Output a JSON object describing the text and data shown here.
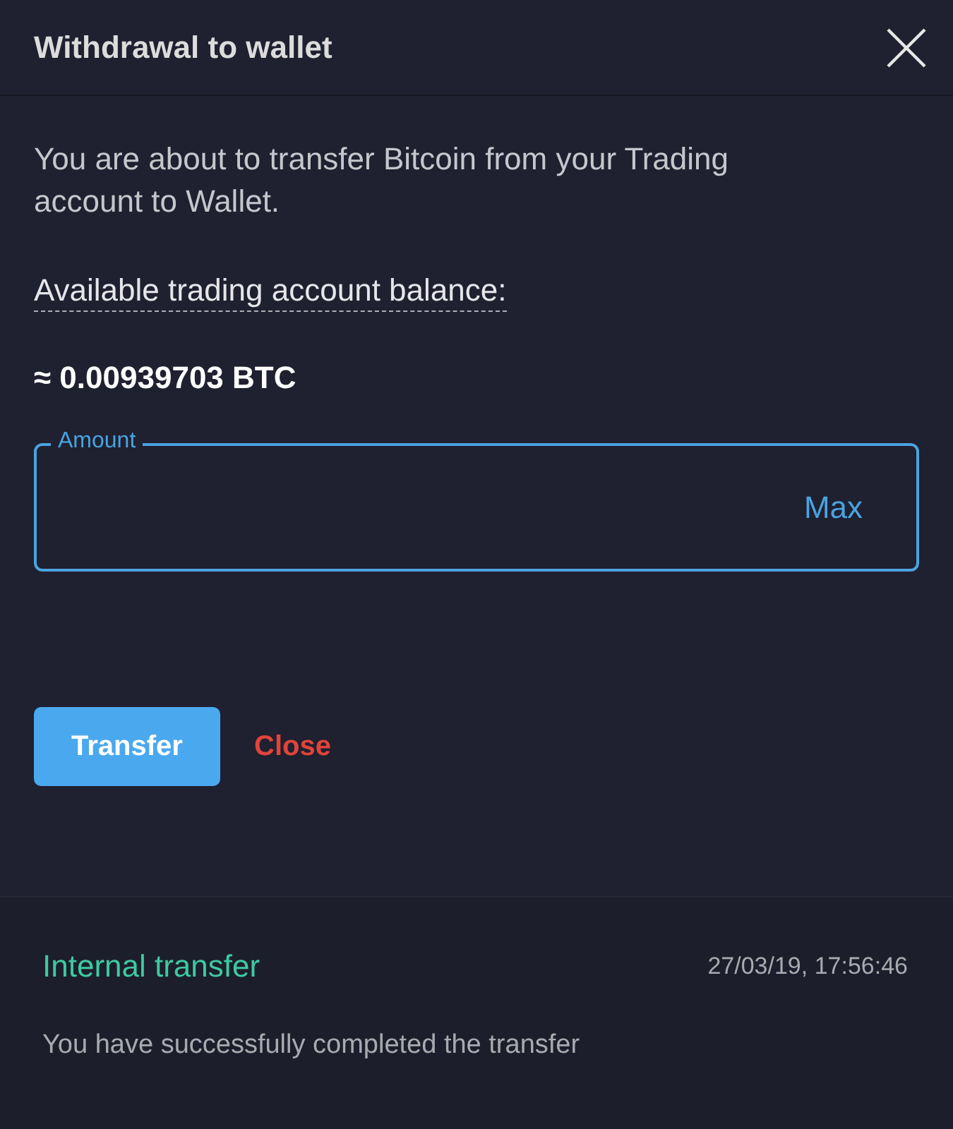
{
  "dialog": {
    "title": "Withdrawal to wallet",
    "message": "You are about to transfer Bitcoin from your Trading account to Wallet.",
    "balance_label": "Available trading account balance:",
    "balance_value": "≈ 0.00939703 BTC",
    "amount_field": {
      "label": "Amount",
      "action": "Max"
    },
    "buttons": [
      {
        "label": "Transfer",
        "kind": "primary"
      },
      {
        "label": "Close",
        "kind": "danger-link"
      }
    ]
  },
  "notification": {
    "title": "Internal transfer",
    "time": "27/03/19, 17:56:46",
    "message": "You have successfully completed the transfer"
  }
}
